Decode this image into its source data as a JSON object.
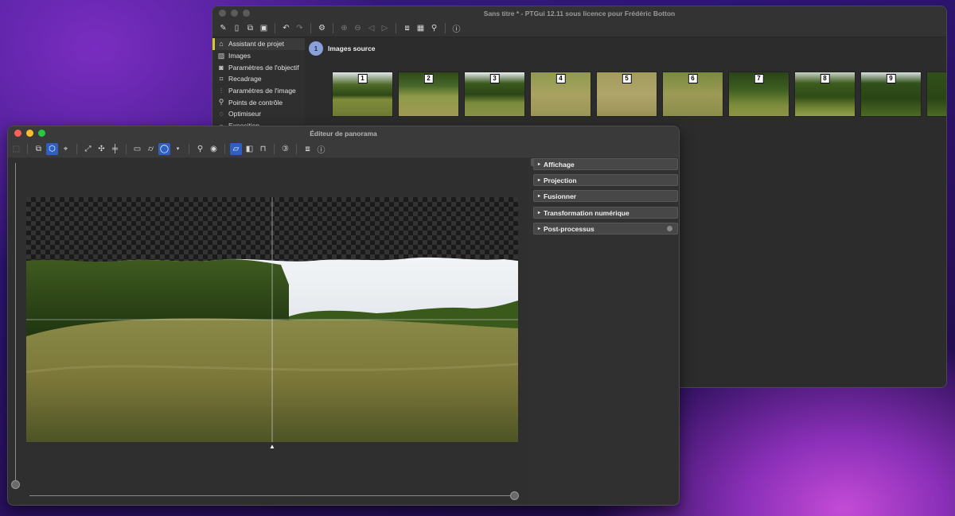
{
  "main_window": {
    "title": "Sans titre * - PTGui 12.11 sous licence pour Frédéric Botton",
    "toolbar_icons": [
      "new-project-icon",
      "open-icon",
      "copy-icon",
      "save-icon",
      "undo-icon",
      "redo-icon",
      "settings-icon",
      "zoom-in-icon",
      "zoom-out-icon",
      "previous-icon",
      "next-icon",
      "panorama-editor-icon",
      "table-icon",
      "location-icon",
      "help-icon"
    ],
    "sidebar": {
      "items": [
        {
          "label": "Assistant de projet",
          "icon": "home-icon",
          "active": true
        },
        {
          "label": "Images",
          "icon": "images-icon",
          "active": false
        },
        {
          "label": "Paramètres de l'objectif",
          "icon": "camera-icon",
          "active": false
        },
        {
          "label": "Recadrage",
          "icon": "crop-icon",
          "active": false
        },
        {
          "label": "Paramètres de l'image",
          "icon": "sliders-icon",
          "active": false
        },
        {
          "label": "Points de contrôle",
          "icon": "control-points-icon",
          "active": false
        },
        {
          "label": "Optimiseur",
          "icon": "optimizer-icon",
          "active": false
        },
        {
          "label": "Exposition",
          "icon": "exposure-icon",
          "active": false
        }
      ]
    },
    "step": {
      "number": "1",
      "title": "Images source"
    },
    "thumbnails": [
      "1",
      "2",
      "3",
      "4",
      "5",
      "6",
      "7",
      "8",
      "9"
    ]
  },
  "pano_editor": {
    "title": "Éditeur de panorama",
    "toolbar_icons": [
      "select-icon",
      "pano-view-icon",
      "pano-edit-icon",
      "crosshair-icon",
      "fit-icon",
      "center-icon",
      "level-icon",
      "rectilinear-icon",
      "cylindrical-icon",
      "spherical-icon",
      "dropdown-icon",
      "zoom-icon",
      "eye-icon",
      "frame-icon",
      "half-frame-icon",
      "book-icon",
      "number-icon",
      "layers-icon",
      "help-icon"
    ],
    "sections": [
      {
        "label": "Affichage"
      },
      {
        "label": "Projection"
      },
      {
        "label": "Fusionner"
      },
      {
        "label": "Transformation numérique"
      },
      {
        "label": "Post-processus"
      }
    ]
  },
  "colors": {
    "accent_active": "#d8c830",
    "selected_tool": "#2f5fc0",
    "step_badge": "#8aa0d8"
  }
}
